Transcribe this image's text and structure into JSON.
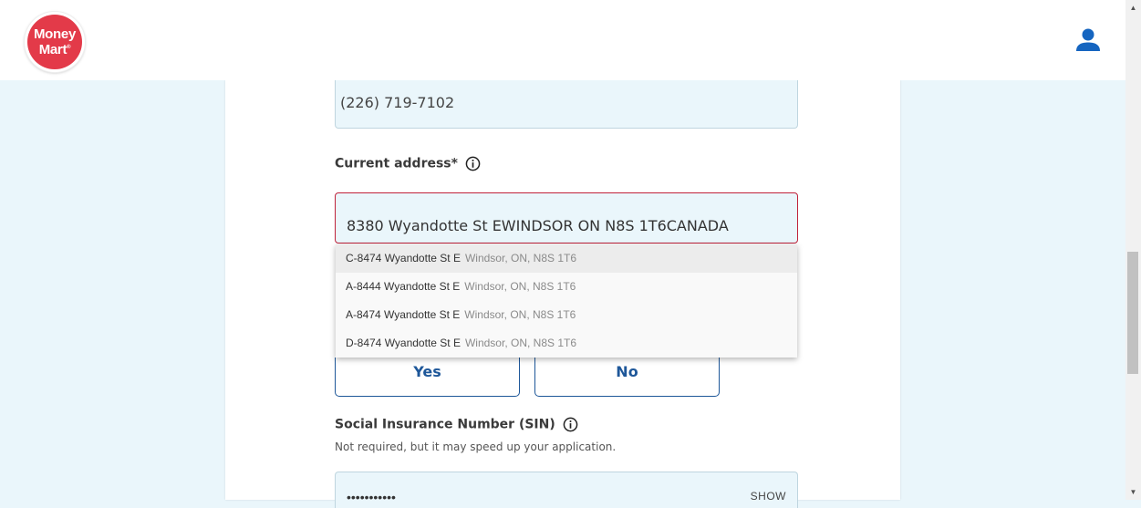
{
  "header": {
    "logo": {
      "line1": "Money",
      "line2": "Mart",
      "mark": "®"
    },
    "user_icon": "user-icon"
  },
  "form": {
    "phone_value": "(226) 719-7102",
    "address_label": "Current address*",
    "address_value": "8380 Wyandotte St EWINDSOR ON N8S 1T6CANADA",
    "suggestions": [
      {
        "main": "C-8474 Wyandotte St E",
        "sub": "Windsor, ON, N8S 1T6"
      },
      {
        "main": "A-8444 Wyandotte St E",
        "sub": "Windsor, ON, N8S 1T6"
      },
      {
        "main": "A-8474 Wyandotte St E",
        "sub": "Windsor, ON, N8S 1T6"
      },
      {
        "main": "D-8474 Wyandotte St E",
        "sub": "Windsor, ON, N8S 1T6"
      }
    ],
    "yes_label": "Yes",
    "no_label": "No",
    "sin_label": "Social Insurance Number (SIN)",
    "sin_helper": "Not required, but it may speed up your application.",
    "sin_value": "•••••••••••",
    "sin_show": "SHOW"
  },
  "colors": {
    "brand": "#e33a49",
    "primary": "#1e5799",
    "error": "#c0223a",
    "field_bg": "#eaf6fb"
  }
}
